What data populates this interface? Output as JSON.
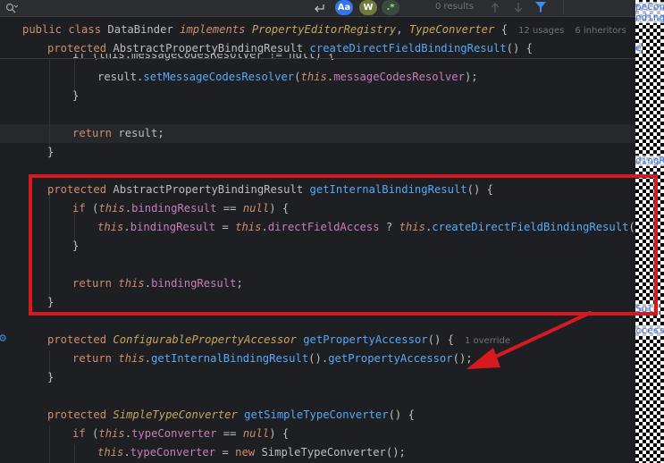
{
  "findbar": {
    "search_icon": "search-icon",
    "input_value": "",
    "return_icon": "return-icon",
    "match_case_label": "Aa",
    "words_label": "W",
    "regex_label": ".*",
    "results_text": "0 results",
    "prev_icon": "arrow-up-icon",
    "next_icon": "arrow-down-icon",
    "filter_icon": "filter-icon"
  },
  "code": {
    "class_header": {
      "kw1": "public",
      "kw2": "class",
      "name": "DataBinder",
      "kw3": "implements",
      "iface1": "PropertyEditorRegistry",
      "comma": ",",
      "iface2": "TypeConverter",
      "brace": "{",
      "usages": "12 usages",
      "inheritors": "6 inheritors"
    },
    "sticky_method": {
      "kw": "protected",
      "type": "AbstractPropertyBindingResult",
      "name": "createDirectFieldBindingResult",
      "rest": "() {"
    },
    "l1_partial": "if (this.messageCodesResolver != null) {",
    "l2": {
      "a": "result.",
      "b": "setMessageCodesResolver",
      "c": "(",
      "d": "this",
      "e": ".",
      "f": "messageCodesResolver",
      "g": ");"
    },
    "l3": "}",
    "l5": {
      "kw": "return",
      "rest": " result;"
    },
    "l6": "}",
    "m1": {
      "kw": "protected",
      "type": "AbstractPropertyBindingResult",
      "name": "getInternalBindingResult",
      "rest": "() {",
      "if_kw": "if",
      "if_open": " (",
      "if_this": "this",
      "if_dot": ".",
      "if_field": "bindingResult",
      "if_op": " == ",
      "if_null": "null",
      "if_close": ") {",
      "assign_this": "this",
      "assign_dot": ".",
      "assign_field": "bindingResult",
      "assign_eq": " = ",
      "assign_this2": "this",
      "assign_dot2": ".",
      "assign_field2": "directFieldAccess",
      "assign_q": " ? ",
      "assign_this3": "this",
      "assign_dot3": ".",
      "assign_call": "createDirectFieldBindingResult",
      "assign_tail": "() :",
      "close_if": "}",
      "ret_kw": "return",
      "ret_this": " this",
      "ret_dot": ".",
      "ret_field": "bindingResult",
      "ret_semi": ";",
      "close": "}"
    },
    "m2": {
      "kw": "protected",
      "type": "ConfigurablePropertyAccessor",
      "name": "getPropertyAccessor",
      "rest": "() {",
      "override_hint": "1 override",
      "ret_kw": "return",
      "ret_this": " this",
      "ret_dot": ".",
      "ret_call1": "getInternalBindingResult",
      "ret_mid": "().",
      "ret_call2": "getPropertyAccessor",
      "ret_tail": "();",
      "close": "}"
    },
    "m3": {
      "kw": "protected",
      "type": "SimpleTypeConverter",
      "name": "getSimpleTypeConverter",
      "rest": "() {",
      "if_kw": "if",
      "if_open": " (",
      "if_this": "this",
      "if_dot": ".",
      "if_field": "typeConverter",
      "if_op": " == ",
      "if_null": "null",
      "if_close": ") {",
      "a_this": "this",
      "a_dot": ".",
      "a_field": "typeConverter",
      "a_eq": " = ",
      "a_new": "new",
      "a_type": " SimpleTypeConverter",
      "a_tail": "();"
    }
  },
  "fragments": [
    "peCon",
    "nding",
    "e",
    "dingRes",
    "Sult",
    "ccess"
  ],
  "colors": {
    "annotation_red": "#d71920",
    "editor_bg": "#1e1f22",
    "accent_blue": "#3574f0"
  }
}
